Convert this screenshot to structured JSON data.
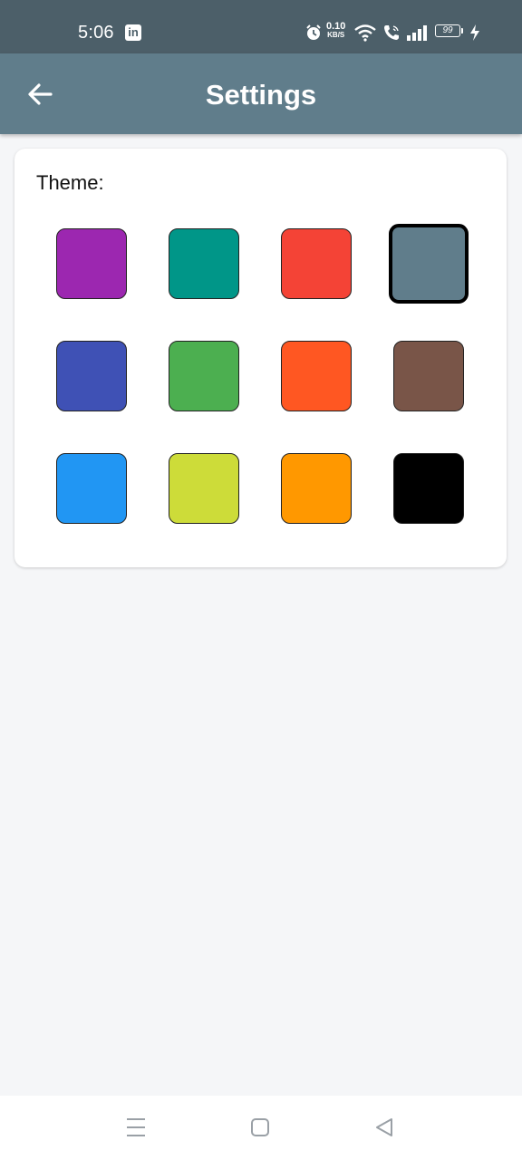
{
  "status_bar": {
    "time": "5:06",
    "notification_icon": "linkedin-icon",
    "net_speed_value": "0.10",
    "net_speed_unit": "KB/S",
    "battery_level": "99",
    "icons": [
      "alarm-icon",
      "wifi-icon",
      "call-icon",
      "signal-icon",
      "battery-icon",
      "charging-icon"
    ]
  },
  "app_bar": {
    "title": "Settings",
    "back_icon": "back-arrow-icon",
    "background": "#607d8b"
  },
  "theme_section": {
    "label": "Theme:",
    "selected_index": 3,
    "swatches": [
      {
        "color": "#9c27b0",
        "selected": false
      },
      {
        "color": "#009688",
        "selected": false
      },
      {
        "color": "#f44336",
        "selected": false
      },
      {
        "color": "#607d8b",
        "selected": true
      },
      {
        "color": "#3f51b5",
        "selected": false
      },
      {
        "color": "#4caf50",
        "selected": false
      },
      {
        "color": "#ff5722",
        "selected": false
      },
      {
        "color": "#795548",
        "selected": false
      },
      {
        "color": "#2196f3",
        "selected": false
      },
      {
        "color": "#cddc39",
        "selected": false
      },
      {
        "color": "#ff9800",
        "selected": false
      },
      {
        "color": "#000000",
        "selected": false
      }
    ]
  },
  "nav_bar": {
    "buttons": [
      "menu-icon",
      "home-icon",
      "back-icon"
    ]
  }
}
